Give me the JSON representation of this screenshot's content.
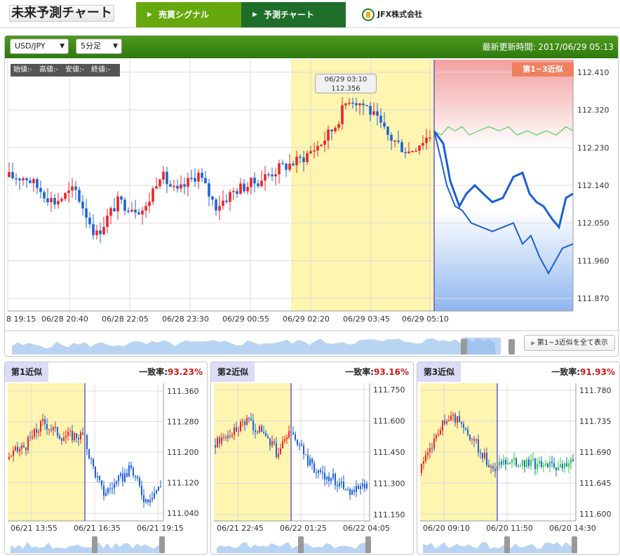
{
  "header": {
    "logo": "未来予測チャート",
    "tabs": [
      {
        "label": "売買シグナル"
      },
      {
        "label": "予測チャート"
      }
    ],
    "company": "JFX株式会社"
  },
  "toolbar": {
    "pair": "USD/JPY",
    "interval": "5分足",
    "updated": "最新更新時間: 2017/06/29 05:13"
  },
  "ohlc": {
    "open": "始値:-",
    "high": "高値:-",
    "low": "安値:-",
    "close": "終値:-"
  },
  "tooltip": {
    "time": "06/29 03:10",
    "price": "112.356"
  },
  "range_badge": "第1~3近似",
  "show_all_button": "第1~3近似を全て表示",
  "colors": {
    "up": "#e8252a",
    "down": "#1e63d6",
    "forecast": "#1a5fd6",
    "alt": "#2ecc40",
    "highlight": "#fdf5b0"
  },
  "chart_data": [
    {
      "id": "main",
      "type": "candlestick",
      "xticks": [
        "8 19:15",
        "06/28 20:40",
        "06/28 22:05",
        "06/28 23:30",
        "06/29 00:55",
        "06/29 02:20",
        "06/29 03:45",
        "06/29 05:10"
      ],
      "yticks": [
        112.41,
        112.32,
        112.23,
        112.14,
        112.05,
        111.96,
        111.87
      ],
      "ylim": [
        111.84,
        112.44
      ],
      "grid": true
    },
    {
      "id": "sub1",
      "type": "candlestick",
      "title": "第1近似",
      "rate_label": "一致率:",
      "rate": "93.23%",
      "xticks": [
        "06/21 13:55",
        "06/21 16:35",
        "06/21 19:15"
      ],
      "yticks": [
        111.36,
        111.28,
        111.2,
        111.12,
        111.04
      ],
      "ylim": [
        111.02,
        111.38
      ]
    },
    {
      "id": "sub2",
      "type": "candlestick",
      "title": "第2近似",
      "rate_label": "一致率:",
      "rate": "93.16%",
      "xticks": [
        "06/21 22:45",
        "06/22 01:25",
        "06/22 04:05"
      ],
      "yticks": [
        111.75,
        111.6,
        111.45,
        111.3,
        111.15
      ],
      "ylim": [
        111.12,
        111.78
      ]
    },
    {
      "id": "sub3",
      "type": "candlestick",
      "title": "第3近似",
      "rate_label": "一致率:",
      "rate": "91.93%",
      "xticks": [
        "06/20 09:10",
        "06/20 11:50",
        "06/20 14:30"
      ],
      "yticks": [
        111.78,
        111.735,
        111.69,
        111.645,
        111.6
      ],
      "ylim": [
        111.59,
        111.79
      ]
    }
  ]
}
